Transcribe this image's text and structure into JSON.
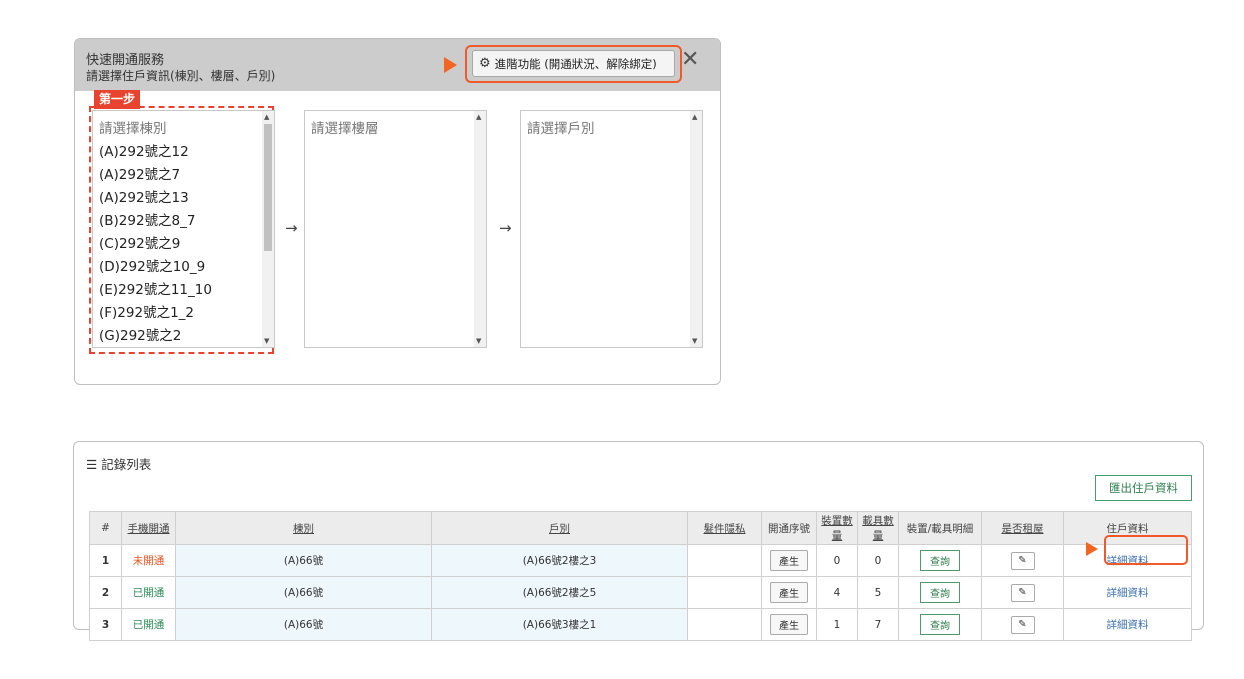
{
  "quick_service": {
    "title": "快速開通服務",
    "subtitle": "請選擇住戶資訊(棟別、樓層、戶別)",
    "advanced_button": "進階功能 (開通狀況、解除綁定)",
    "advanced_icon": "gears-icon",
    "close_glyph": "✕",
    "step_label": "第一步",
    "building_list": {
      "placeholder": "請選擇棟別",
      "options": [
        "(A)292號之12",
        "(A)292號之7",
        "(A)292號之13",
        "(B)292號之8_7",
        "(C)292號之9",
        "(D)292號之10_9",
        "(E)292號之11_10",
        "(F)292號之1_2",
        "(G)292號之2"
      ]
    },
    "floor_list": {
      "placeholder": "請選擇樓層"
    },
    "unit_list": {
      "placeholder": "請選擇戶別"
    },
    "arrow_glyph": "→",
    "highlight_color": "#ef5a2b",
    "step_color": "#e8432e"
  },
  "records": {
    "title": "記錄列表",
    "title_icon": "list-icon",
    "export_button": "匯出住戶資料",
    "columns": [
      "#",
      "手機開通",
      "棟別",
      "戶別",
      "髮件隱私",
      "開通序號",
      "裝置數量",
      "載具數量",
      "裝置/載具明細",
      "是否租屋",
      "住戶資料"
    ],
    "rows": [
      {
        "index": "1",
        "status": "未開通",
        "status_state": "off",
        "building": "(A)66號",
        "unit": "(A)66號2樓之3",
        "privacy": "",
        "serial_button": "產生",
        "devices": "0",
        "carriers": "0",
        "detail_button": "查詢",
        "rental_icon": "pencil-icon",
        "resident_link": "詳細資料"
      },
      {
        "index": "2",
        "status": "已開通",
        "status_state": "on",
        "building": "(A)66號",
        "unit": "(A)66號2樓之5",
        "privacy": "",
        "serial_button": "產生",
        "devices": "4",
        "carriers": "5",
        "detail_button": "查詢",
        "rental_icon": "pencil-icon",
        "resident_link": "詳細資料"
      },
      {
        "index": "3",
        "status": "已開通",
        "status_state": "on",
        "building": "(A)66號",
        "unit": "(A)66號3樓之1",
        "privacy": "",
        "serial_button": "產生",
        "devices": "1",
        "carriers": "7",
        "detail_button": "查詢",
        "rental_icon": "pencil-icon",
        "resident_link": "詳細資料"
      }
    ],
    "status_off_color": "#e8531f",
    "status_on_color": "#2e8b57"
  }
}
